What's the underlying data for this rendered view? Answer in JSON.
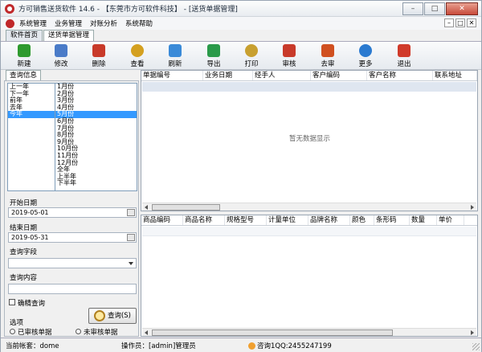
{
  "window": {
    "title": "方可销售送货软件 14.6 - 【东莞市方可软件科技】 - [送货单据管理]"
  },
  "menu": [
    "系统管理",
    "业务管理",
    "对账分析",
    "系统帮助"
  ],
  "tabs": [
    "软件首页",
    "送货单据管理"
  ],
  "toolbar": [
    {
      "label": "新建",
      "icon": "add-icon",
      "color": "#2e9a2e"
    },
    {
      "label": "修改",
      "icon": "edit-icon",
      "color": "#4a7bc8"
    },
    {
      "label": "删除",
      "icon": "delete-icon",
      "color": "#c83a2a"
    },
    {
      "label": "查看",
      "icon": "view-icon",
      "color": "#d4a020"
    },
    {
      "label": "刷新",
      "icon": "refresh-icon",
      "color": "#3a8ad8"
    },
    {
      "label": "导出",
      "icon": "export-icon",
      "color": "#2a9a4a"
    },
    {
      "label": "打印",
      "icon": "print-icon",
      "color": "#c8a030"
    },
    {
      "label": "审核",
      "icon": "audit-icon",
      "color": "#c83a2a"
    },
    {
      "label": "去审",
      "icon": "unaudit-icon",
      "color": "#d05020"
    },
    {
      "label": "更多",
      "icon": "more-icon",
      "color": "#2a7ad0"
    },
    {
      "label": "退出",
      "icon": "exit-icon",
      "color": "#d03a2a"
    }
  ],
  "query": {
    "tab": "查询信息",
    "years": [
      "上一年",
      "下一年",
      "前年",
      "去年",
      "今年"
    ],
    "selected_year_index": 4,
    "months": [
      "1月份",
      "2月份",
      "3月份",
      "4月份",
      "5月份",
      "6月份",
      "7月份",
      "8月份",
      "9月份",
      "10月份",
      "11月份",
      "12月份",
      "全年",
      "上半年",
      "下半年"
    ],
    "selected_month_index": 4,
    "start_label": "开始日期",
    "start_value": "2019-05-01",
    "end_label": "结束日期",
    "end_value": "2019-05-31",
    "field_label": "查询字段",
    "content_label": "查询内容",
    "exact_label": "确精查询",
    "query_button": "查询(S)",
    "options_label": "选项",
    "opt_audited": "已审核单据",
    "opt_unaudited": "未审核单据"
  },
  "top_grid": {
    "columns": [
      "单据编号",
      "业务日期",
      "经手人",
      "客户编码",
      "客户名称",
      "联系地址"
    ],
    "empty_text": "暂无数据显示"
  },
  "bottom_grid": {
    "columns": [
      "商品编码",
      "商品名称",
      "规格型号",
      "计量单位",
      "品牌名称",
      "颜色",
      "条形码",
      "数量",
      "单价"
    ]
  },
  "status": {
    "account": "当前帐套：dome",
    "operator": "操作员：[admin]管理员",
    "qq": "咨询1QQ:2455247199"
  }
}
